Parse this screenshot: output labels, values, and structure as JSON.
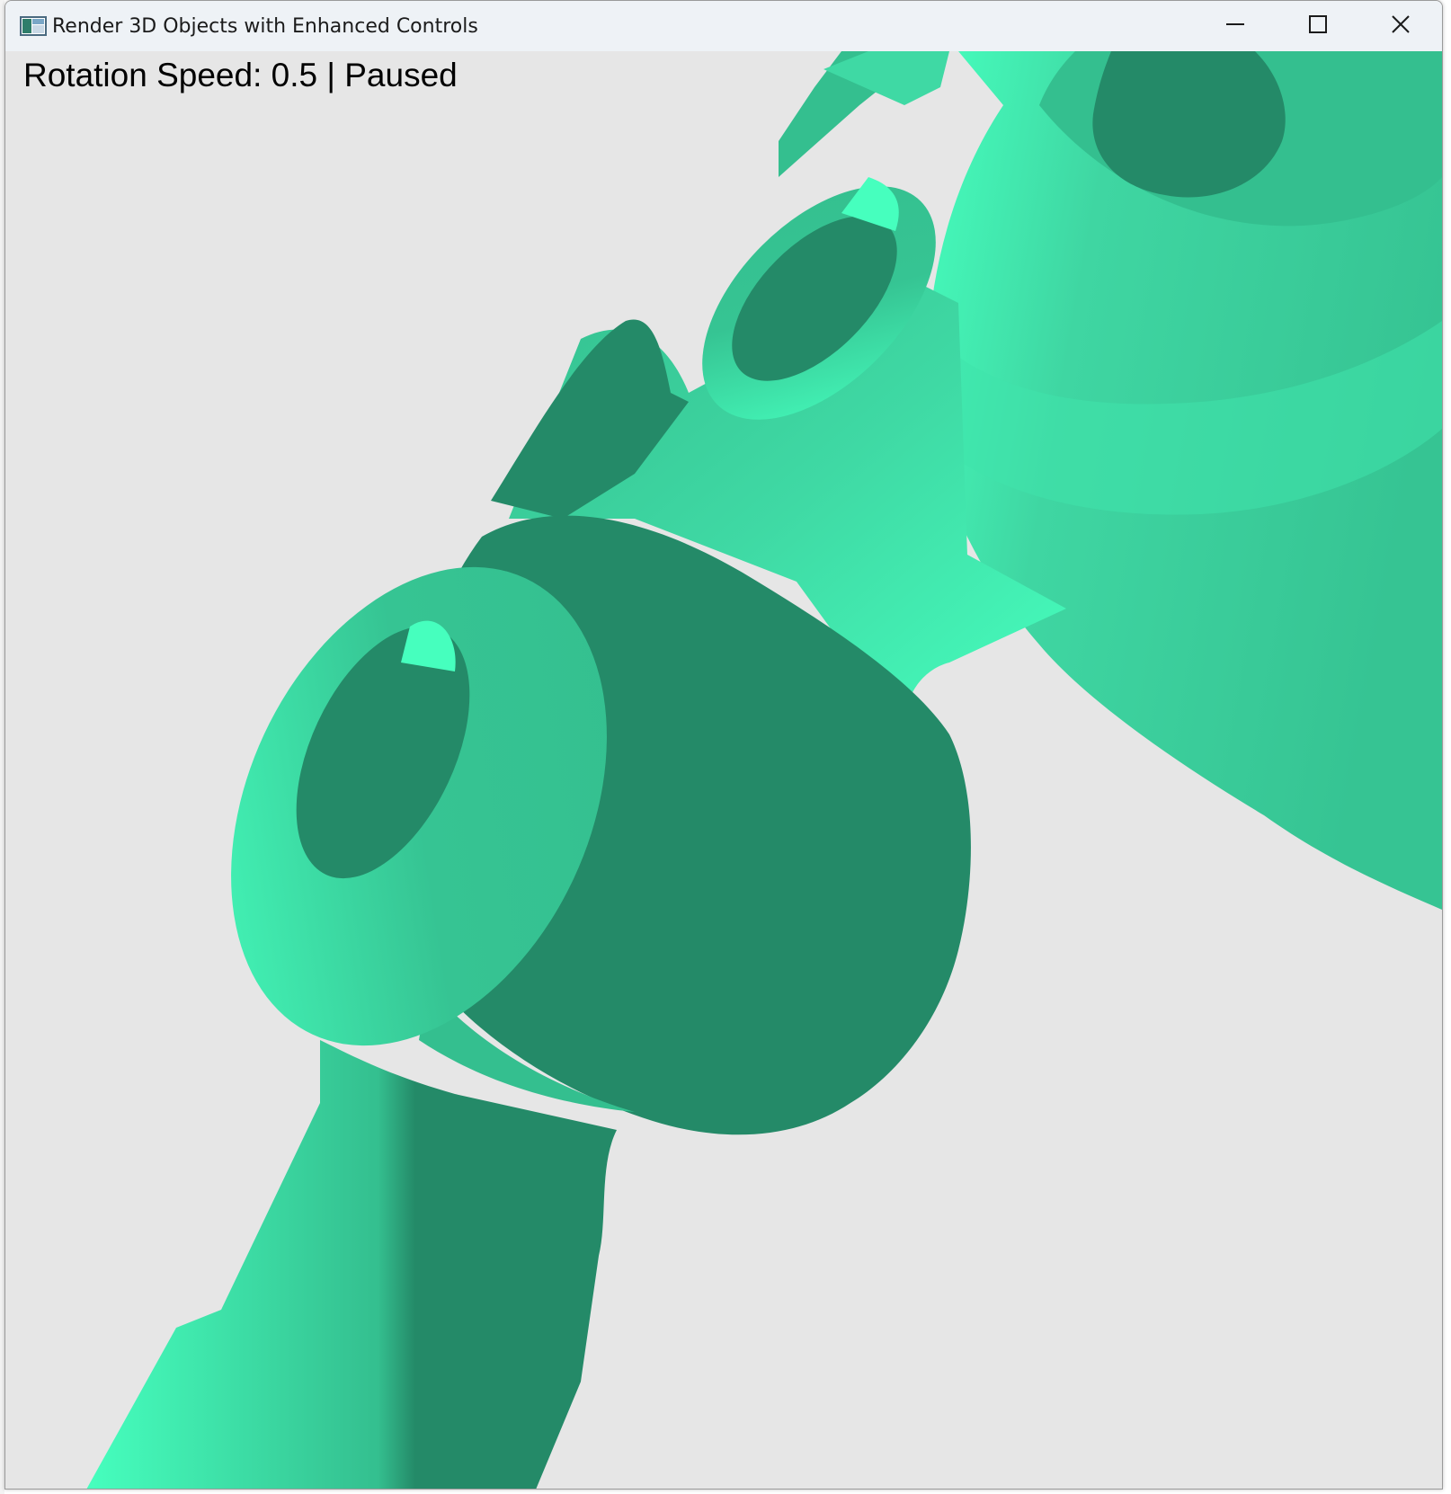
{
  "window": {
    "title": "Render 3D Objects with Enhanced Controls",
    "icon": "app-window-icon",
    "controls": {
      "minimize_icon": "minimize-icon",
      "maximize_icon": "maximize-icon",
      "close_icon": "close-icon"
    }
  },
  "viewport": {
    "hud": {
      "status_text": "Rotation Speed: 0.5 | Paused"
    },
    "background_color": "#e6e6e6",
    "model_colors": {
      "light": "#46ffbe",
      "mid": "#34bf8f",
      "dark": "#248a68"
    }
  }
}
